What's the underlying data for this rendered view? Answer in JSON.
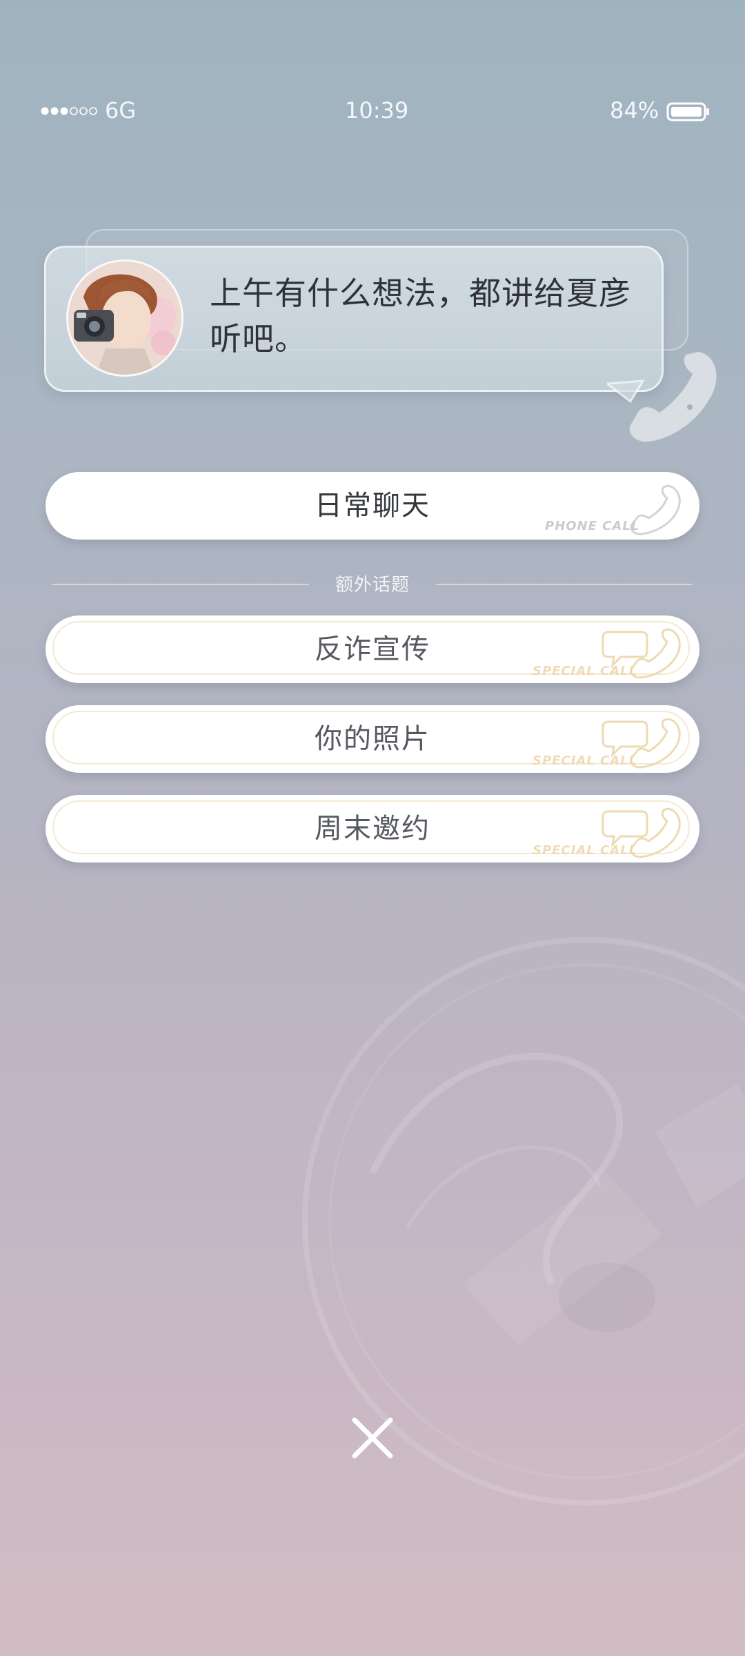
{
  "status_bar": {
    "carrier": "6G",
    "time": "10:39",
    "battery": "84%"
  },
  "dialog": {
    "message": "上午有什么想法，都讲给夏彦听吧。"
  },
  "options": {
    "daily_chat": {
      "label": "日常聊天",
      "deco_text": "PHONE CALL"
    },
    "divider_label": "额外话题",
    "topics": [
      {
        "label": "反诈宣传",
        "deco_text": "SPECIAL CALL"
      },
      {
        "label": "你的照片",
        "deco_text": "SPECIAL CALL"
      },
      {
        "label": "周末邀约",
        "deco_text": "SPECIAL CALL"
      }
    ]
  },
  "colors": {
    "accent_gold": "#ecd6aa",
    "text_dark": "#34373c"
  },
  "icons": {
    "signal": "signal-dots-icon",
    "battery": "battery-icon",
    "phone": "phone-icon",
    "chat": "chat-bubble-icon",
    "close": "close-icon"
  }
}
